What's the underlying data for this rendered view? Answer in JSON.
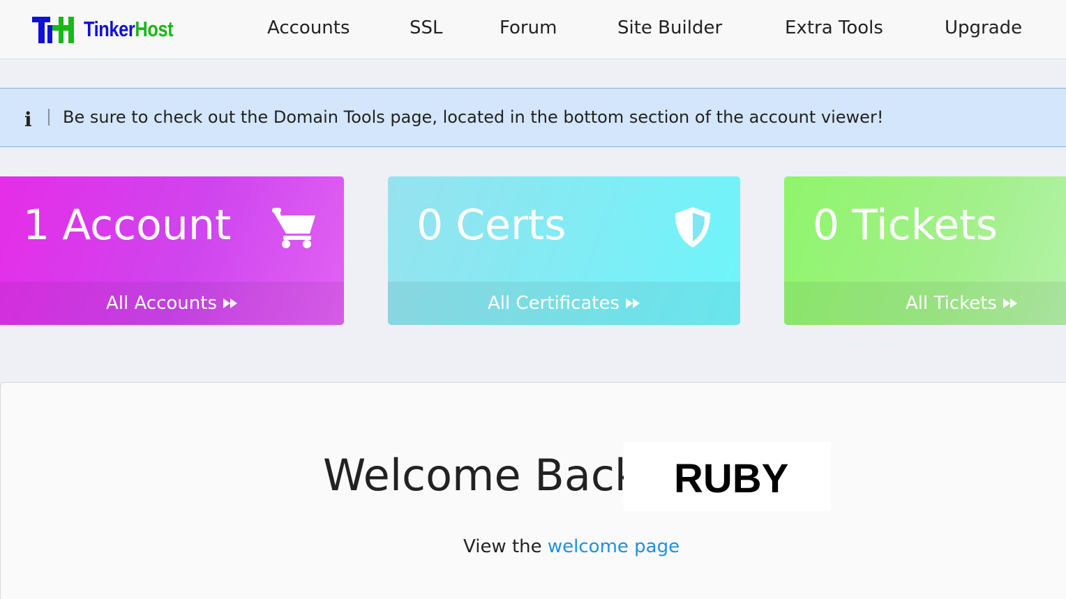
{
  "brand": {
    "logo_part1": "Tinker",
    "logo_part2": "Host"
  },
  "nav": {
    "items": [
      {
        "label": "Accounts"
      },
      {
        "label": "SSL"
      },
      {
        "label": "Forum"
      },
      {
        "label": "Site Builder"
      },
      {
        "label": "Extra Tools"
      },
      {
        "label": "Upgrade"
      }
    ]
  },
  "alert": {
    "icon": "info-icon",
    "text": "Be sure to check out the Domain Tools page, located in the bottom section of the account viewer!"
  },
  "cards": [
    {
      "count": "1",
      "unit": "Account",
      "link": "All Accounts",
      "icon": "cart-icon",
      "color": "#e23de9"
    },
    {
      "count": "0",
      "unit": "Certs",
      "link": "All Certificates",
      "icon": "shield-icon",
      "color": "#84eaf3"
    },
    {
      "count": "0",
      "unit": "Tickets",
      "link": "All Tickets",
      "icon": "none",
      "color": "#9cf27f"
    }
  ],
  "welcome": {
    "heading": "Welcome Back,",
    "name": "RUBY",
    "view_prefix": "View the",
    "view_link": "welcome page",
    "link_color": "#1f8fe0"
  }
}
